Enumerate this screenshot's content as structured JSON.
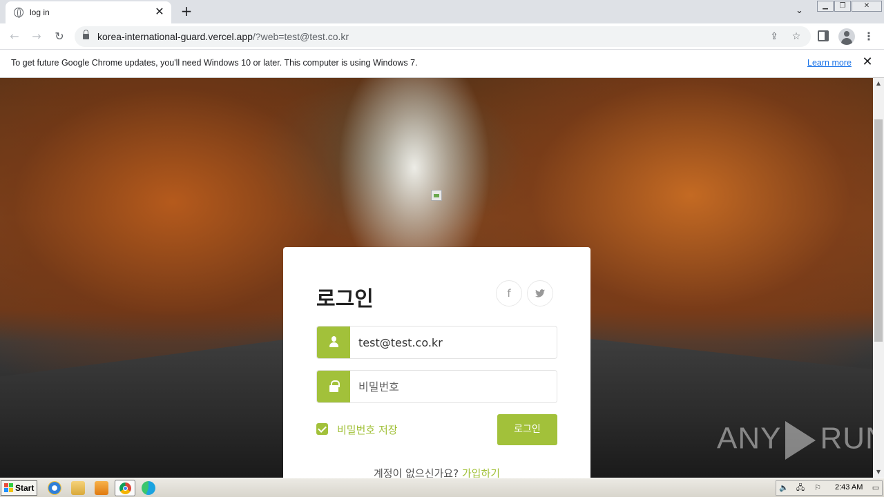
{
  "browser": {
    "tab_title": "log in",
    "tab_close": "✕",
    "new_tab": "+",
    "url_host": "korea-international-guard.vercel.app",
    "url_rest": "/?web=test@test.co.kr"
  },
  "infobar": {
    "message": "To get future Google Chrome updates, you'll need Windows 10 or later. This computer is using Windows 7.",
    "learn_more": "Learn more"
  },
  "login": {
    "title": "로그인",
    "email_value": "test@test.co.kr",
    "password_placeholder": "비밀번호",
    "remember_label": "비밀번호 저장",
    "remember_checked": true,
    "login_button": "로그인",
    "signup_prompt": "계정이 없으신가요?",
    "signup_link": "가입하기",
    "social": {
      "facebook": "f",
      "twitter": "🐦"
    }
  },
  "watermark": {
    "left": "ANY",
    "right": "RUN"
  },
  "taskbar": {
    "start_label": "Start",
    "clock": "2:43 AM"
  },
  "colors": {
    "accent_green": "#a2c13a",
    "link_blue": "#1a73e8"
  }
}
